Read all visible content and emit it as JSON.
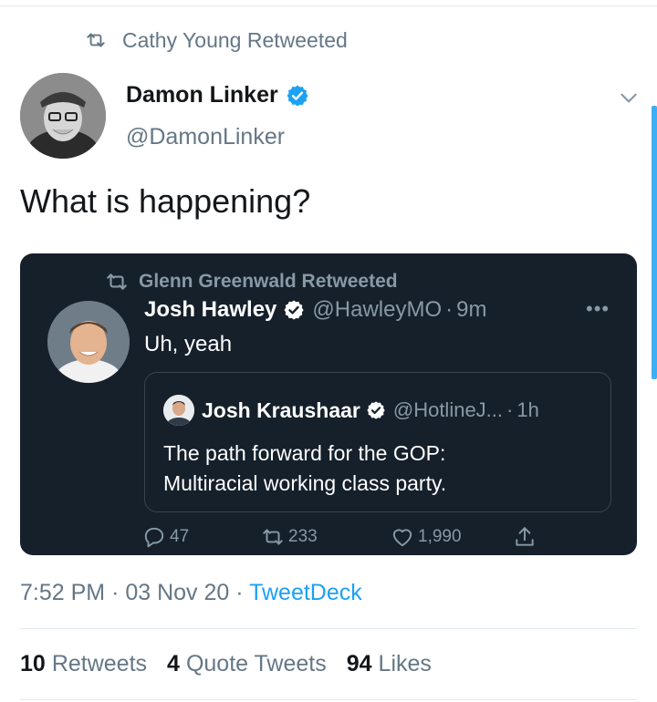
{
  "retweet_banner": {
    "text": "Cathy Young Retweeted"
  },
  "tweet": {
    "author_name": "Damon Linker",
    "author_handle": "@DamonLinker",
    "text": "What is happening?",
    "timestamp": "7:52 PM",
    "date": "03 Nov 20",
    "source": "TweetDeck"
  },
  "embedded": {
    "retweet_banner": "Glenn Greenwald Retweeted",
    "author_name": "Josh Hawley",
    "author_handle": "@HawleyMO",
    "time": "9m",
    "more": "•••",
    "text": "Uh, yeah",
    "quote": {
      "author_name": "Josh Kraushaar",
      "author_handle": "@HotlineJ...",
      "time": "1h",
      "text_line1": "The path forward for the GOP:",
      "text_line2": "Multiracial working class party."
    },
    "actions": {
      "replies": "47",
      "retweets": "233",
      "likes": "1,990"
    }
  },
  "stats": {
    "retweets_count": "10",
    "retweets_label": "Retweets",
    "quotes_count": "4",
    "quotes_label": "Quote Tweets",
    "likes_count": "94",
    "likes_label": "Likes"
  },
  "separator": "·",
  "colors": {
    "accent": "#1da1f2",
    "dark_card": "#15202b",
    "muted": "#657786",
    "dark_muted": "#8899a6"
  }
}
